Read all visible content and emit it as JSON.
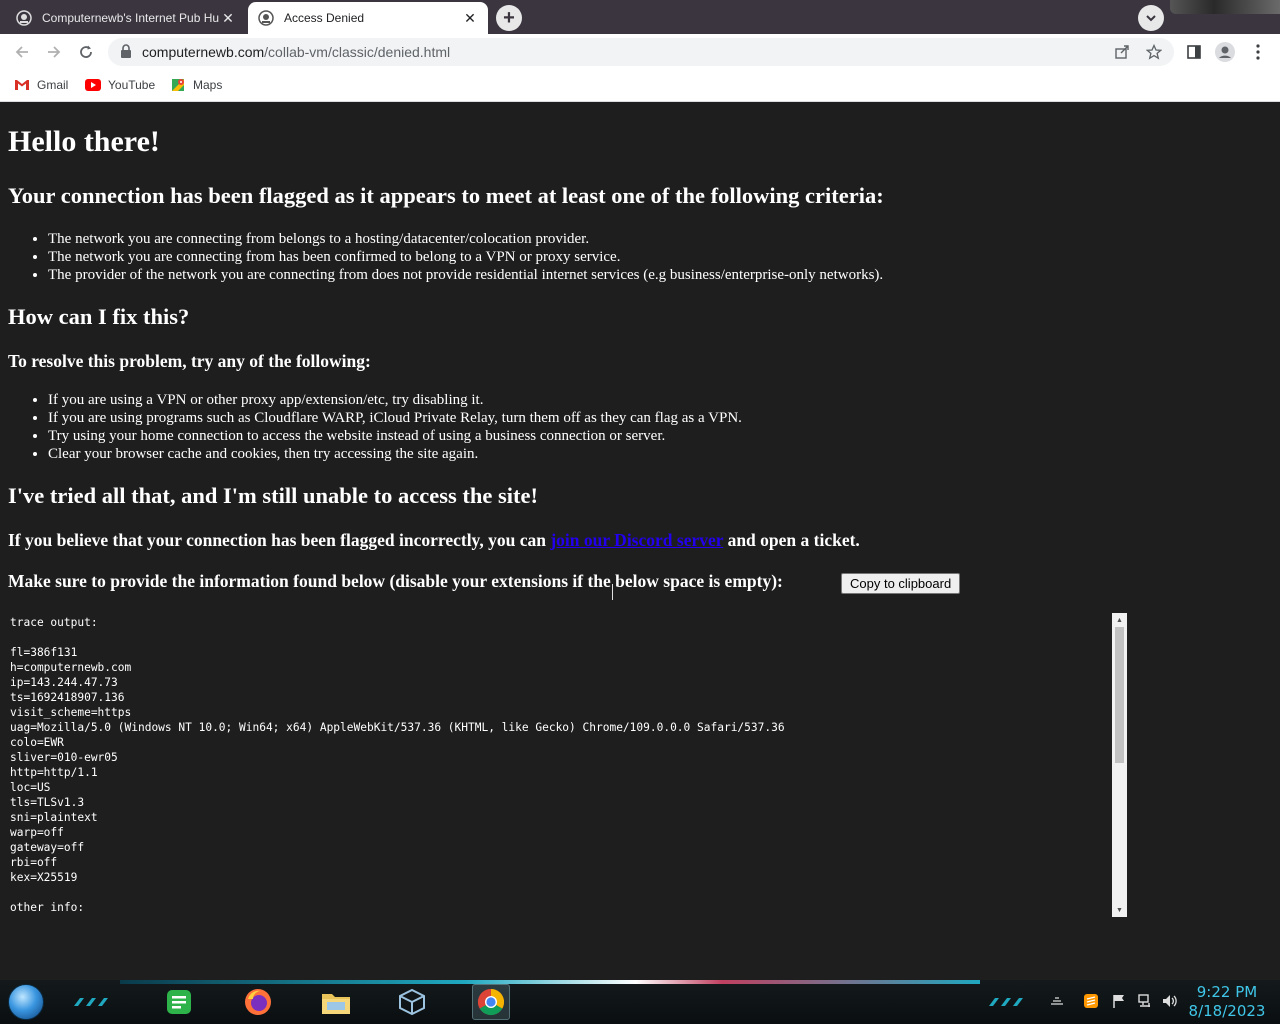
{
  "tabs": [
    {
      "title": "Computernewb's Internet Pub Hu",
      "close": "✕",
      "favicon": "computernewb-icon"
    },
    {
      "title": "Access Denied",
      "close": "✕",
      "favicon": "computernewb-icon"
    }
  ],
  "newtab_label": "+",
  "address": {
    "domain": "computernewb.com",
    "path": "/collab-vm/classic/denied.html"
  },
  "bookmarks": [
    {
      "label": "Gmail",
      "icon": "gmail-icon"
    },
    {
      "label": "YouTube",
      "icon": "youtube-icon"
    },
    {
      "label": "Maps",
      "icon": "maps-icon"
    }
  ],
  "page": {
    "title": "Hello there!",
    "flag_heading": "Your connection has been flagged as it appears to meet at least one of the following criteria:",
    "criteria": [
      "The network you are connecting from belongs to a hosting/datacenter/colocation provider.",
      "The network you are connecting from has been confirmed to belong to a VPN or proxy service.",
      "The provider of the network you are connecting from does not provide residential internet services (e.g business/enterprise-only networks)."
    ],
    "fix_heading": "How can I fix this?",
    "resolve_heading": "To resolve this problem, try any of the following:",
    "fixes": [
      "If you are using a VPN or other proxy app/extension/etc, try disabling it.",
      "If you are using programs such as Cloudflare WARP, iCloud Private Relay, turn them off as they can flag as a VPN.",
      "Try using your home connection to access the website instead of using a business connection or server.",
      "Clear your browser cache and cookies, then try accessing the site again."
    ],
    "still_heading": "I've tried all that, and I'm still unable to access the site!",
    "believe_prefix": "If you believe that your connection has been flagged incorrectly, you can ",
    "discord_link": "join our Discord server",
    "believe_suffix": " and open a ticket.",
    "provide_text": "Make sure to provide the information found below (disable your extensions if the below space is empty):",
    "copy_button": "Copy to clipboard",
    "trace": "trace output:\n\nfl=386f131\nh=computernewb.com\nip=143.244.47.73\nts=1692418907.136\nvisit_scheme=https\nuag=Mozilla/5.0 (Windows NT 10.0; Win64; x64) AppleWebKit/537.36 (KHTML, like Gecko) Chrome/109.0.0.0 Safari/537.36\ncolo=EWR\nsliver=010-ewr05\nhttp=http/1.1\nloc=US\ntls=TLSv1.3\nsni=plaintext\nwarp=off\ngateway=off\nrbi=off\nkex=X25519\n\nother info:"
  },
  "taskbar": {
    "apps": [
      "notes-icon",
      "firefox-icon",
      "file-explorer-icon",
      "virtualbox-icon",
      "chrome-icon"
    ],
    "time": "9:22 PM",
    "date": "8/18/2023"
  },
  "colors": {
    "link": "#2200ee",
    "page_bg": "#1e1e1e",
    "clock": "#3fc6e8"
  }
}
